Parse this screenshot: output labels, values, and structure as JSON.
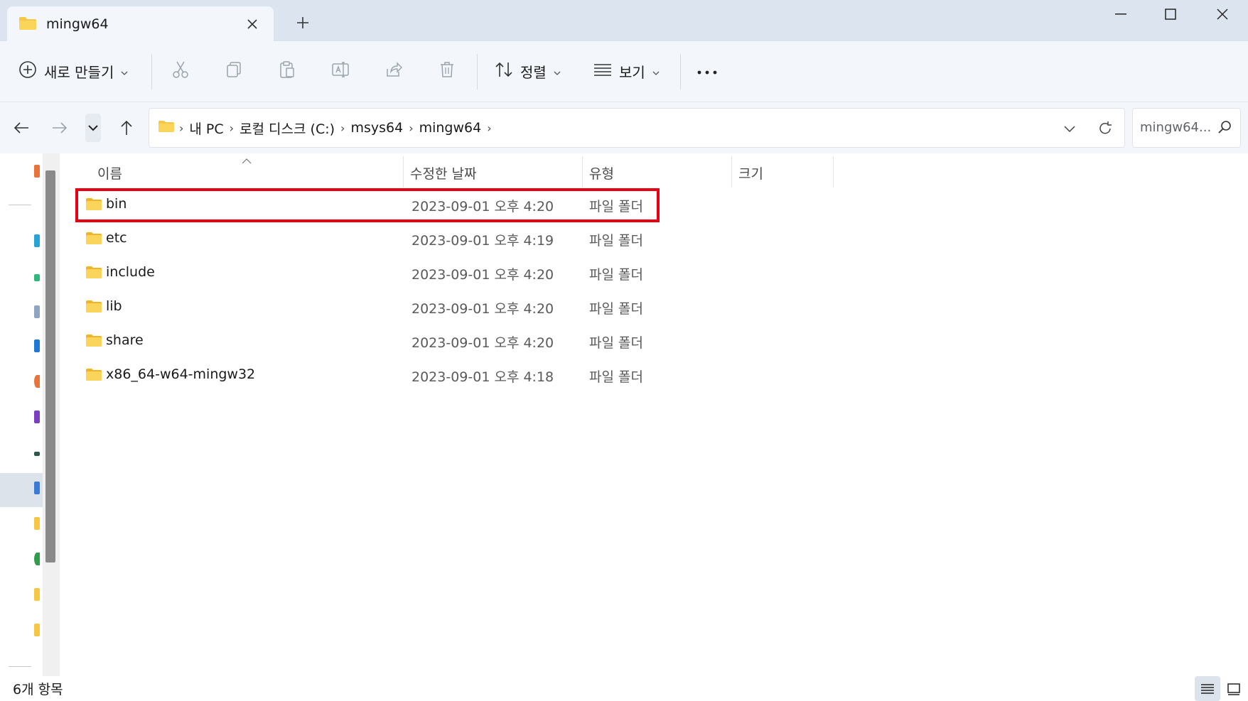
{
  "tab": {
    "title": "mingw64"
  },
  "toolbar": {
    "new_label": "새로 만들기",
    "sort_label": "정렬",
    "view_label": "보기"
  },
  "address": {
    "crumbs": [
      "내 PC",
      "로컬 디스크 (C:)",
      "msys64",
      "mingw64"
    ]
  },
  "search": {
    "placeholder": "mingw64..."
  },
  "columns": {
    "name": "이름",
    "date": "수정한 날짜",
    "type": "유형",
    "size": "크기"
  },
  "files": [
    {
      "name": "bin",
      "date": "2023-09-01 오후 4:20",
      "type": "파일 폴더"
    },
    {
      "name": "etc",
      "date": "2023-09-01 오후 4:19",
      "type": "파일 폴더"
    },
    {
      "name": "include",
      "date": "2023-09-01 오후 4:20",
      "type": "파일 폴더"
    },
    {
      "name": "lib",
      "date": "2023-09-01 오후 4:20",
      "type": "파일 폴더"
    },
    {
      "name": "share",
      "date": "2023-09-01 오후 4:20",
      "type": "파일 폴더"
    },
    {
      "name": "x86_64-w64-mingw32",
      "date": "2023-09-01 오후 4:18",
      "type": "파일 폴더"
    }
  ],
  "status": {
    "count": "6개 항목"
  },
  "colors": {
    "highlight": "#e60012",
    "folder": "#f6c744",
    "titlebar": "#dbe4ef",
    "toolbar": "#f3f6fa"
  },
  "icons": [
    "folder-icon",
    "close-icon",
    "plus-icon",
    "minimize-icon",
    "maximize-icon",
    "add-circle-icon",
    "cut-icon",
    "copy-icon",
    "paste-icon",
    "rename-icon",
    "share-icon",
    "delete-icon",
    "sort-icon",
    "view-icon",
    "more-icon",
    "back-icon",
    "forward-icon",
    "chevron-down-icon",
    "up-icon",
    "refresh-icon",
    "search-icon",
    "details-view-icon",
    "tiles-view-icon"
  ]
}
